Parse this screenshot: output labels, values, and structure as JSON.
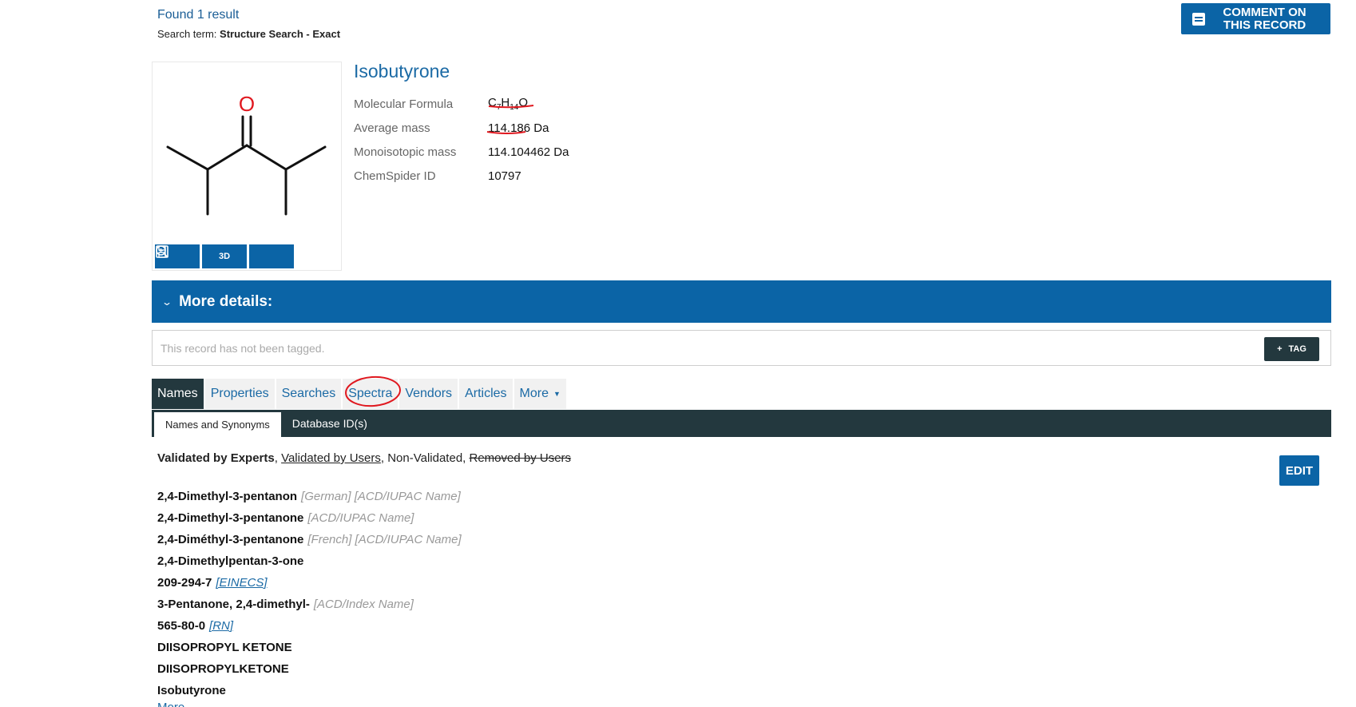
{
  "results": {
    "found_text": "Found 1 result",
    "search_term_label": "Search term:",
    "search_term_value": "Structure Search - Exact"
  },
  "comment_button": {
    "line1": "Comment on",
    "line2": "this record"
  },
  "compound": {
    "name": "Isobutyrone",
    "oxygen_label": "O",
    "tools": {
      "save": "save",
      "three_d": "3D",
      "zoom": "zoom"
    },
    "properties": [
      {
        "label": "Molecular Formula",
        "value_parts": [
          "C",
          "7",
          "H",
          "14",
          "O"
        ]
      },
      {
        "label": "Average mass",
        "value": "114.186 Da"
      },
      {
        "label": "Monoisotopic mass",
        "value": "114.104462 Da"
      },
      {
        "label": "ChemSpider ID",
        "value": "10797"
      }
    ]
  },
  "more_details": {
    "title": "More details:"
  },
  "tagging": {
    "placeholder": "This record has not been tagged.",
    "tag_button": "TAG"
  },
  "tabs": [
    {
      "label": "Names",
      "active": true
    },
    {
      "label": "Properties"
    },
    {
      "label": "Searches"
    },
    {
      "label": "Spectra"
    },
    {
      "label": "Vendors"
    },
    {
      "label": "Articles"
    },
    {
      "label": "More"
    }
  ],
  "subtabs": [
    {
      "label": "Names and Synonyms",
      "active": true
    },
    {
      "label": "Database ID(s)"
    }
  ],
  "legend": {
    "experts": "Validated by Experts",
    "sep1": ", ",
    "users": "Validated by Users",
    "sep2": ", Non-Validated, ",
    "removed": "Removed by Users"
  },
  "edit_button": "EDIT",
  "names": [
    {
      "name": "2,4-Dimethyl-3-pentanon",
      "meta": "[German] [ACD/IUPAC Name]"
    },
    {
      "name": "2,4-Dimethyl-3-pentanone",
      "meta": "[ACD/IUPAC Name]"
    },
    {
      "name": "2,4-Diméthyl-3-pentanone",
      "meta": "[French] [ACD/IUPAC Name]"
    },
    {
      "name": "2,4-Dimethylpentan-3-one",
      "meta": ""
    },
    {
      "name": "209-294-7",
      "link": "[EINECS]"
    },
    {
      "name": "3-Pentanone, 2,4-dimethyl-",
      "meta": "[ACD/Index Name]"
    },
    {
      "name": "565-80-0",
      "link": "[RN]"
    },
    {
      "name": "DIISOPROPYL KETONE",
      "meta": ""
    },
    {
      "name": "DIISOPROPYLKETONE",
      "meta": ""
    },
    {
      "name": "Isobutyrone",
      "meta": ""
    }
  ],
  "more_link": "More...",
  "colors": {
    "primary": "#0b64a6",
    "dark_bar": "#23383e",
    "link": "#1b6aa5",
    "annotation": "#e0181f"
  }
}
